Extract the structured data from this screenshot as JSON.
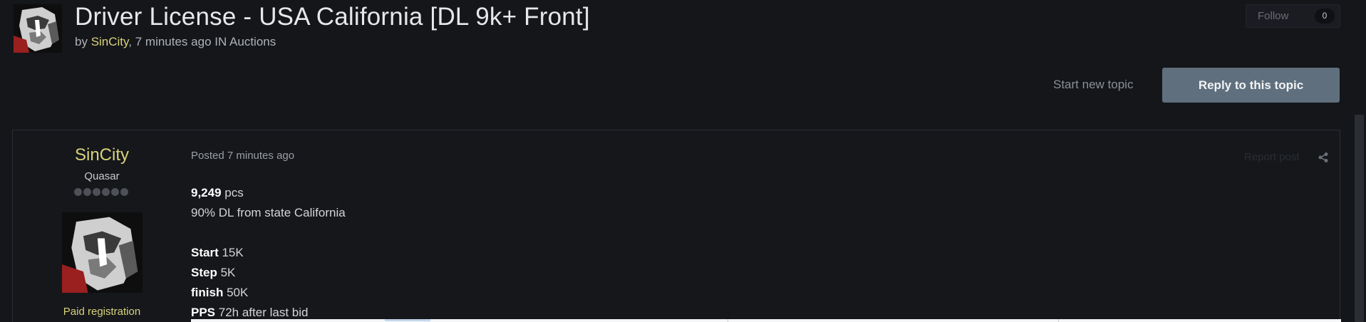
{
  "topic": {
    "title": "Driver License - USA California [DL 9k+ Front]",
    "by_prefix": "by ",
    "author": "SinCity",
    "time_text": ", 7 minutes ago IN ",
    "forum": "Auctions"
  },
  "follow": {
    "label": "Follow",
    "count": "0"
  },
  "actions": {
    "start_new_topic": "Start new topic",
    "reply": "Reply to this topic"
  },
  "post": {
    "author_name": "SinCity",
    "author_rank": "Quasar",
    "author_group": "Paid registration",
    "posted": "Posted 7 minutes ago",
    "report": "Report post",
    "body": {
      "count_value": "9,249",
      "count_unit": " pcs",
      "line2": "90% DL from state California",
      "start_label": "Start",
      "start_value": " 15K",
      "step_label": "Step",
      "step_value": " 5K",
      "finish_label": "finish",
      "finish_value": " 50K",
      "pps_label": "PPS",
      "pps_value": " 72h after last bid"
    }
  },
  "icons": {
    "share": "share-icon",
    "rank": "rank-pip-icon"
  },
  "colors": {
    "background": "#14161a",
    "username": "#d9d27b",
    "reply_button": "#5f6f7d"
  }
}
